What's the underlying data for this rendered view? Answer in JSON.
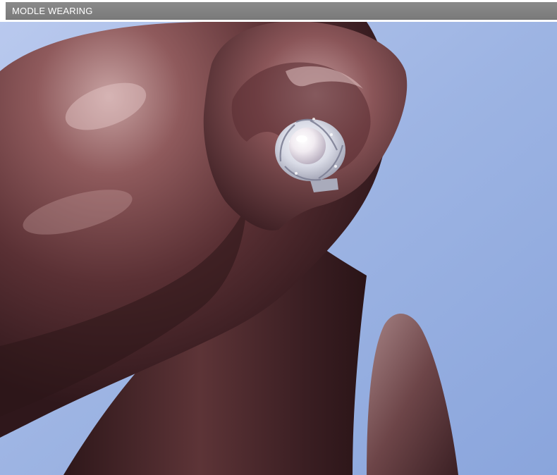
{
  "section": {
    "title": "MODLE WEARING"
  },
  "photo": {
    "subject": "pearl-flower-stud-earring-on-mannequin-ear",
    "colors": {
      "background_blue": "#9db4e3",
      "mannequin_dark": "#3a1f22",
      "mannequin_mid": "#6e3f42",
      "mannequin_highlight": "#b89090",
      "pearl": "#f3eef4",
      "silver": "#d9dbe6"
    }
  }
}
